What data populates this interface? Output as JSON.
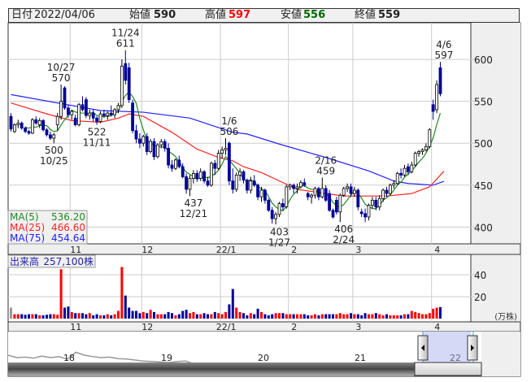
{
  "header": {
    "date_label": "日付",
    "date": "2022/04/06",
    "open_label": "始値",
    "open": "590",
    "high_label": "高値",
    "high": "597",
    "low_label": "安値",
    "low": "556",
    "close_label": "終値",
    "close": "559"
  },
  "legend": {
    "ma5_label": "MA(5)",
    "ma5_value": "536.20",
    "ma25_label": "MA(25)",
    "ma25_value": "466.60",
    "ma75_label": "MA(75)",
    "ma75_value": "454.64",
    "volume_label": "出来高",
    "volume_value": "257,100株",
    "volume_unit": "(万株)"
  },
  "colors": {
    "up_volume": "#ff0000",
    "down_volume": "#000099",
    "flat_volume": "#999999",
    "down_candle": "#000099",
    "ma5": "#228822",
    "ma25": "#ff2222",
    "ma75": "#2222ff",
    "navigator_selection": "#aab4ee"
  },
  "chart_data": {
    "type": "candlestick",
    "ylim": [
      380,
      634
    ],
    "y_ticks": [
      600,
      550,
      500,
      450,
      400
    ],
    "volume_ticks": [
      40,
      20
    ],
    "volume_ylim": [
      0,
      56
    ],
    "x_ticks": [
      {
        "index": 17,
        "label": "11"
      },
      {
        "index": 37,
        "label": "12"
      },
      {
        "index": 59,
        "label": "22/1"
      },
      {
        "index": 78,
        "label": "2"
      },
      {
        "index": 96,
        "label": "3"
      },
      {
        "index": 118,
        "label": "4"
      }
    ],
    "ohlc": [
      [
        532,
        536,
        514,
        517
      ],
      [
        514,
        524,
        512,
        522
      ],
      [
        522,
        528,
        518,
        524
      ],
      [
        524,
        526,
        516,
        518
      ],
      [
        518,
        520,
        512,
        514
      ],
      [
        514,
        516,
        510,
        512
      ],
      [
        512,
        530,
        511,
        528
      ],
      [
        528,
        532,
        522,
        524
      ],
      [
        522,
        530,
        518,
        527
      ],
      [
        527,
        529,
        514,
        516
      ],
      [
        516,
        518,
        508,
        510
      ],
      [
        510,
        514,
        504,
        506
      ],
      [
        506,
        512,
        500,
        510
      ],
      [
        522,
        536,
        515,
        532
      ],
      [
        532,
        570,
        528,
        550
      ],
      [
        566,
        568,
        540,
        542
      ],
      [
        542,
        546,
        530,
        534
      ],
      [
        534,
        540,
        528,
        538
      ],
      [
        530,
        534,
        520,
        522
      ],
      [
        522,
        548,
        520,
        546
      ],
      [
        546,
        556,
        538,
        540
      ],
      [
        552,
        555,
        530,
        533
      ],
      [
        533,
        540,
        528,
        536
      ],
      [
        536,
        540,
        526,
        530
      ],
      [
        530,
        532,
        522,
        526
      ],
      [
        526,
        538,
        524,
        535
      ],
      [
        535,
        540,
        530,
        533
      ],
      [
        533,
        538,
        528,
        536
      ],
      [
        536,
        545,
        532,
        534
      ],
      [
        534,
        542,
        530,
        540
      ],
      [
        540,
        548,
        536,
        545
      ],
      [
        545,
        600,
        542,
        592
      ],
      [
        595,
        611,
        570,
        575
      ],
      [
        590,
        596,
        548,
        552
      ],
      [
        548,
        552,
        512,
        515
      ],
      [
        515,
        522,
        500,
        505
      ],
      [
        505,
        512,
        494,
        500
      ],
      [
        500,
        510,
        496,
        508
      ],
      [
        508,
        512,
        486,
        490
      ],
      [
        490,
        505,
        488,
        502
      ],
      [
        502,
        506,
        480,
        484
      ],
      [
        484,
        500,
        482,
        498
      ],
      [
        498,
        505,
        494,
        502
      ],
      [
        502,
        505,
        490,
        494
      ],
      [
        494,
        500,
        470,
        474
      ],
      [
        474,
        480,
        466,
        470
      ],
      [
        470,
        482,
        468,
        480
      ],
      [
        480,
        485,
        470,
        472
      ],
      [
        472,
        476,
        458,
        460
      ],
      [
        460,
        464,
        440,
        445
      ],
      [
        445,
        462,
        437,
        458
      ],
      [
        458,
        468,
        452,
        464
      ],
      [
        464,
        468,
        454,
        458
      ],
      [
        458,
        470,
        455,
        466
      ],
      [
        466,
        468,
        452,
        455
      ],
      [
        455,
        460,
        448,
        450
      ],
      [
        450,
        478,
        448,
        476
      ],
      [
        476,
        480,
        462,
        470
      ],
      [
        470,
        492,
        468,
        488
      ],
      [
        488,
        496,
        482,
        492
      ],
      [
        492,
        506,
        486,
        494
      ],
      [
        500,
        502,
        450,
        455
      ],
      [
        455,
        470,
        440,
        445
      ],
      [
        445,
        465,
        442,
        462
      ],
      [
        462,
        470,
        455,
        466
      ],
      [
        466,
        468,
        452,
        456
      ],
      [
        456,
        458,
        440,
        444
      ],
      [
        444,
        460,
        440,
        455
      ],
      [
        455,
        462,
        448,
        450
      ],
      [
        450,
        452,
        432,
        436
      ],
      [
        436,
        448,
        430,
        444
      ],
      [
        444,
        446,
        428,
        432
      ],
      [
        432,
        434,
        418,
        420
      ],
      [
        420,
        424,
        404,
        410
      ],
      [
        410,
        418,
        403,
        415
      ],
      [
        415,
        430,
        412,
        428
      ],
      [
        428,
        434,
        420,
        424
      ],
      [
        424,
        450,
        422,
        448
      ],
      [
        448,
        452,
        444,
        450
      ],
      [
        450,
        452,
        440,
        446
      ],
      [
        446,
        452,
        440,
        448
      ],
      [
        448,
        456,
        446,
        453
      ],
      [
        453,
        458,
        448,
        450
      ],
      [
        440,
        442,
        432,
        436
      ],
      [
        436,
        440,
        428,
        438
      ],
      [
        438,
        448,
        434,
        446
      ],
      [
        446,
        448,
        432,
        436
      ],
      [
        436,
        459,
        434,
        446
      ],
      [
        446,
        450,
        430,
        432
      ],
      [
        440,
        444,
        418,
        420
      ],
      [
        420,
        422,
        410,
        412
      ],
      [
        432,
        436,
        415,
        418
      ],
      [
        418,
        440,
        406,
        438
      ],
      [
        438,
        448,
        436,
        446
      ],
      [
        446,
        452,
        442,
        448
      ],
      [
        448,
        452,
        436,
        440
      ],
      [
        440,
        448,
        436,
        444
      ],
      [
        444,
        446,
        420,
        424
      ],
      [
        418,
        422,
        412,
        416
      ],
      [
        416,
        422,
        406,
        412
      ],
      [
        412,
        428,
        408,
        426
      ],
      [
        426,
        436,
        422,
        432
      ],
      [
        432,
        436,
        420,
        424
      ],
      [
        424,
        438,
        420,
        434
      ],
      [
        434,
        446,
        430,
        444
      ],
      [
        444,
        448,
        436,
        440
      ],
      [
        440,
        452,
        438,
        450
      ],
      [
        450,
        456,
        446,
        452
      ],
      [
        452,
        466,
        450,
        464
      ],
      [
        464,
        470,
        458,
        462
      ],
      [
        462,
        474,
        460,
        470
      ],
      [
        472,
        476,
        462,
        466
      ],
      [
        466,
        478,
        464,
        474
      ],
      [
        474,
        490,
        472,
        488
      ],
      [
        488,
        492,
        484,
        490
      ],
      [
        490,
        494,
        486,
        492
      ],
      [
        492,
        500,
        490,
        496
      ],
      [
        496,
        518,
        494,
        516
      ],
      [
        546,
        552,
        528,
        538
      ],
      [
        540,
        575,
        536,
        570
      ],
      [
        590,
        597,
        556,
        559
      ]
    ],
    "volume": [
      10,
      4,
      4,
      4,
      3.5,
      4,
      4,
      4,
      3,
      3,
      3.5,
      4,
      4,
      3.5,
      45,
      10,
      11,
      6,
      5,
      5,
      5,
      4,
      5,
      3,
      4,
      3,
      3,
      4,
      3,
      4,
      7,
      47,
      21,
      10,
      7,
      7,
      5,
      6,
      5,
      8,
      6,
      4,
      4,
      4,
      6,
      5,
      3,
      4,
      7,
      8,
      5,
      6,
      4,
      4,
      5,
      4,
      4,
      6,
      5,
      4,
      6,
      13,
      27,
      10,
      6,
      5,
      3,
      5,
      4,
      9,
      6,
      4,
      3,
      4,
      5,
      5,
      5,
      4,
      4,
      4,
      4,
      4,
      4,
      3,
      3,
      4,
      3,
      4,
      4,
      4,
      4,
      4,
      5,
      4,
      4,
      5,
      4,
      4,
      3,
      5,
      4,
      4,
      5,
      4,
      3,
      4,
      3,
      3,
      3,
      3,
      4,
      4,
      7,
      6,
      5,
      4,
      4,
      5,
      9,
      10,
      10.5,
      25.71
    ],
    "ma25_points": [
      [
        0,
        548
      ],
      [
        10,
        535
      ],
      [
        17,
        527
      ],
      [
        25,
        525
      ],
      [
        30,
        530
      ],
      [
        33,
        535
      ],
      [
        37,
        532
      ],
      [
        45,
        513
      ],
      [
        52,
        493
      ],
      [
        58,
        483
      ],
      [
        62,
        479
      ],
      [
        65,
        472
      ],
      [
        70,
        465
      ],
      [
        75,
        455
      ],
      [
        80,
        445
      ],
      [
        88,
        440
      ],
      [
        93,
        437
      ],
      [
        100,
        437
      ],
      [
        105,
        437
      ],
      [
        112,
        440
      ],
      [
        117,
        448
      ],
      [
        121,
        466.6
      ]
    ],
    "ma75_points": [
      [
        0,
        558
      ],
      [
        17,
        545
      ],
      [
        25,
        539
      ],
      [
        37,
        537
      ],
      [
        50,
        530
      ],
      [
        62,
        513
      ],
      [
        66,
        511
      ],
      [
        75,
        499
      ],
      [
        88,
        483
      ],
      [
        100,
        467
      ],
      [
        107,
        455
      ],
      [
        111,
        452
      ],
      [
        118,
        450
      ],
      [
        121,
        454.64
      ]
    ],
    "annotations": [
      {
        "index": 14,
        "price": 570,
        "pos": "above",
        "line1": "10/27",
        "line2": "570"
      },
      {
        "index": 32,
        "price": 611,
        "pos": "above",
        "line1": "11/24",
        "line2": "611"
      },
      {
        "index": 61,
        "price": 506,
        "pos": "above",
        "line1": "1/6",
        "line2": "506"
      },
      {
        "index": 88,
        "price": 459,
        "pos": "above",
        "line1": "2/16",
        "line2": "459"
      },
      {
        "index": 121,
        "price": 597,
        "pos": "above",
        "line1": "4/6",
        "line2": "597"
      },
      {
        "index": 12,
        "price": 500,
        "pos": "below",
        "line1": "500",
        "line2": "10/25"
      },
      {
        "index": 24,
        "price": 522,
        "pos": "below",
        "line1": "522",
        "line2": "11/11"
      },
      {
        "index": 51,
        "price": 437,
        "pos": "below",
        "line1": "437",
        "line2": "12/21"
      },
      {
        "index": 75,
        "price": 403,
        "pos": "below",
        "line1": "403",
        "line2": "1/27"
      },
      {
        "index": 93,
        "price": 406,
        "pos": "below",
        "line1": "406",
        "line2": "2/24"
      }
    ]
  },
  "navigator": {
    "year_labels": [
      "18",
      "19",
      "20",
      "21",
      "22"
    ],
    "series": [
      60,
      55,
      56,
      54,
      58,
      55,
      57,
      52,
      66,
      60,
      57,
      55,
      56,
      53,
      52,
      50,
      48,
      47,
      46,
      45,
      47,
      48,
      42,
      41,
      40,
      38,
      36,
      37,
      38,
      39,
      38,
      37,
      36,
      38,
      37,
      38,
      37,
      36,
      36,
      36,
      35,
      36,
      37,
      36,
      35,
      34,
      36,
      36,
      36,
      35
    ]
  }
}
